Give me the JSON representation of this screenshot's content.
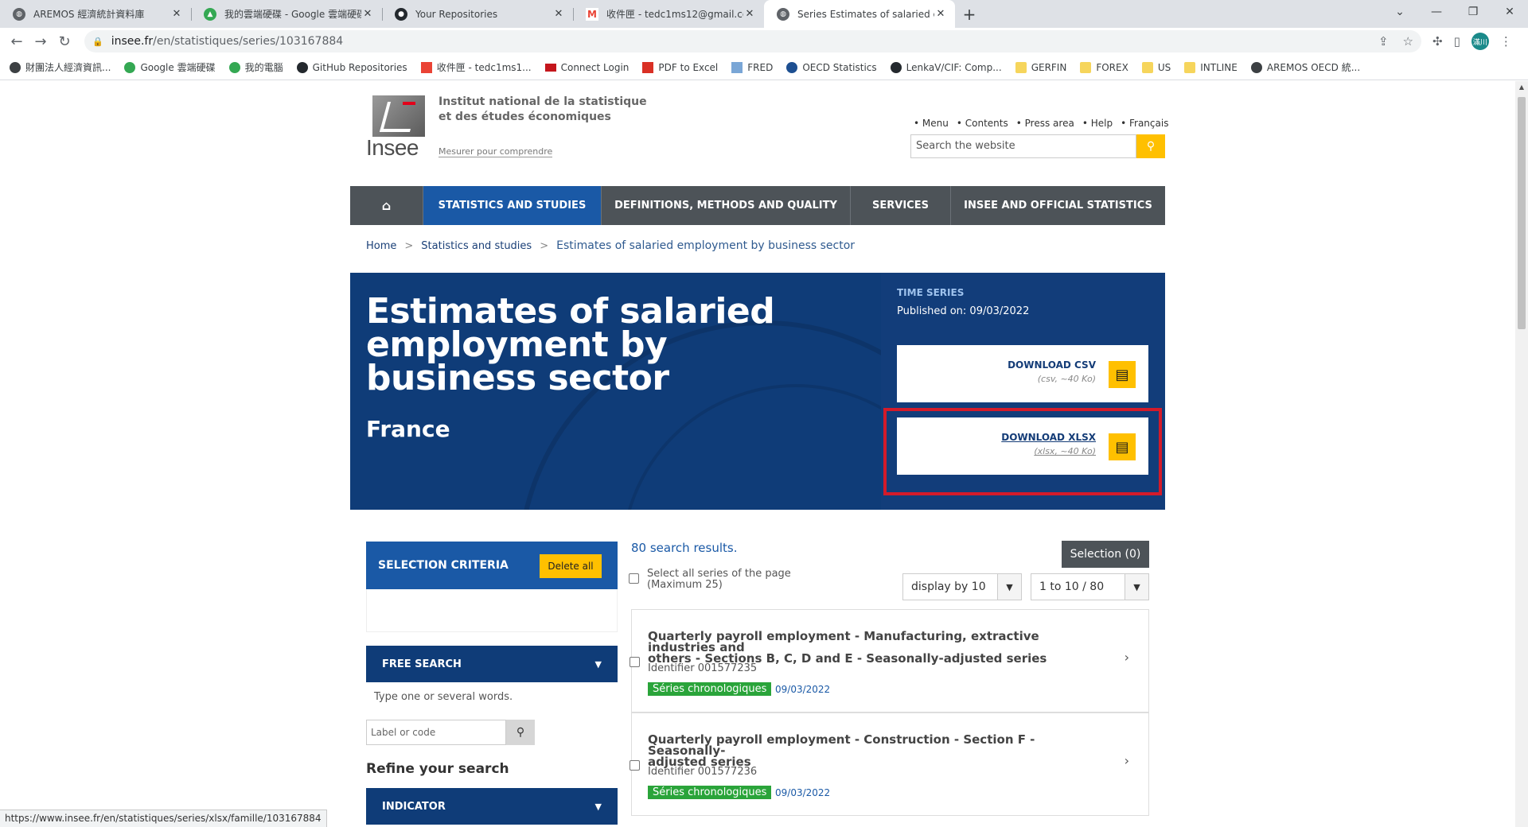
{
  "browser": {
    "tabs": [
      {
        "title": "AREMOS 經濟統計資料庫",
        "icon": "globe-icon"
      },
      {
        "title": "我的雲端硬碟 - Google 雲端硬碟",
        "icon": "drive-icon"
      },
      {
        "title": "Your Repositories",
        "icon": "github-icon"
      },
      {
        "title": "收件匣 - tedc1ms12@gmail.com",
        "icon": "gmail-icon"
      },
      {
        "title": "Series Estimates of salaried em",
        "icon": "globe-icon"
      }
    ],
    "url_host": "insee.fr",
    "url_path": "/en/statistiques/series/103167884",
    "profile_initial": "滿川",
    "bookmarks": [
      {
        "label": "財團法人經濟資訊...",
        "icon": "globe-icon"
      },
      {
        "label": "Google 雲端硬碟",
        "icon": "drive-icon"
      },
      {
        "label": "我的電腦",
        "icon": "drive-icon"
      },
      {
        "label": "GitHub Repositories",
        "icon": "github-icon"
      },
      {
        "label": "收件匣 - tedc1ms1...",
        "icon": "gmail-icon"
      },
      {
        "label": "Connect Login",
        "icon": "flag-icon"
      },
      {
        "label": "PDF to Excel",
        "icon": "pdf-icon"
      },
      {
        "label": "FRED",
        "icon": "chart-icon"
      },
      {
        "label": "OECD Statistics",
        "icon": "oecd-icon"
      },
      {
        "label": "LenkaV/CIF: Comp...",
        "icon": "github-icon"
      },
      {
        "label": "GERFIN",
        "icon": "folder-icon"
      },
      {
        "label": "FOREX",
        "icon": "folder-icon"
      },
      {
        "label": "US",
        "icon": "folder-icon"
      },
      {
        "label": "INTLINE",
        "icon": "folder-icon"
      },
      {
        "label": "AREMOS OECD 統...",
        "icon": "globe-icon"
      }
    ],
    "status_url": "https://www.insee.fr/en/statistiques/series/xlsx/famille/103167884"
  },
  "header": {
    "logo_text": "Insee",
    "institute_line1": "Institut national de la statistique",
    "institute_line2": "et des études économiques",
    "motto": "Mesurer pour comprendre",
    "links": [
      "Menu",
      "Contents",
      "Press area",
      "Help",
      "Français"
    ],
    "search_placeholder": "Search the website"
  },
  "nav": {
    "home_icon": "home-icon",
    "items": [
      "STATISTICS AND STUDIES",
      "DEFINITIONS, METHODS AND QUALITY",
      "SERVICES",
      "INSEE AND OFFICIAL STATISTICS"
    ]
  },
  "breadcrumb": [
    "Home",
    "Statistics and studies",
    "Estimates of salaried employment by business sector"
  ],
  "hero": {
    "title": "Estimates of salaried employment by business sector",
    "country": "France",
    "type_label": "TIME SERIES",
    "published": "Published on: 09/03/2022",
    "csv_label": "DOWNLOAD CSV",
    "csv_sub": "(csv,  ~40 Ko)",
    "xlsx_label": "DOWNLOAD XLSX",
    "xlsx_sub": "(xlsx,  ~40 Ko)"
  },
  "sidebar": {
    "criteria_title": "SELECTION CRITERIA",
    "delete_all": "Delete all",
    "free_search_title": "FREE SEARCH",
    "free_search_hint": "Type one or several words.",
    "free_search_placeholder": "Label or code",
    "refine_title": "Refine your search",
    "indicator_title": "INDICATOR"
  },
  "results": {
    "count_text": "80 search results.",
    "selection_button": "Selection (0)",
    "select_all_line1": "Select all series of the page",
    "select_all_line2": "(Maximum 25)",
    "display_by": "display by 10",
    "pagination": "1 to 10 / 80",
    "items": [
      {
        "title_line1": "Quarterly payroll employment - Manufacturing, extractive industries and",
        "title_line2": "others - Sections B, C, D and E - Seasonally-adjusted series",
        "identifier": "Identifier 001577235",
        "tag": "Séries chronologiques",
        "date": "09/03/2022"
      },
      {
        "title_line1": "Quarterly payroll employment - Construction - Section F - Seasonally-",
        "title_line2": "adjusted series",
        "identifier": "Identifier 001577236",
        "tag": "Séries chronologiques",
        "date": "09/03/2022"
      }
    ]
  }
}
